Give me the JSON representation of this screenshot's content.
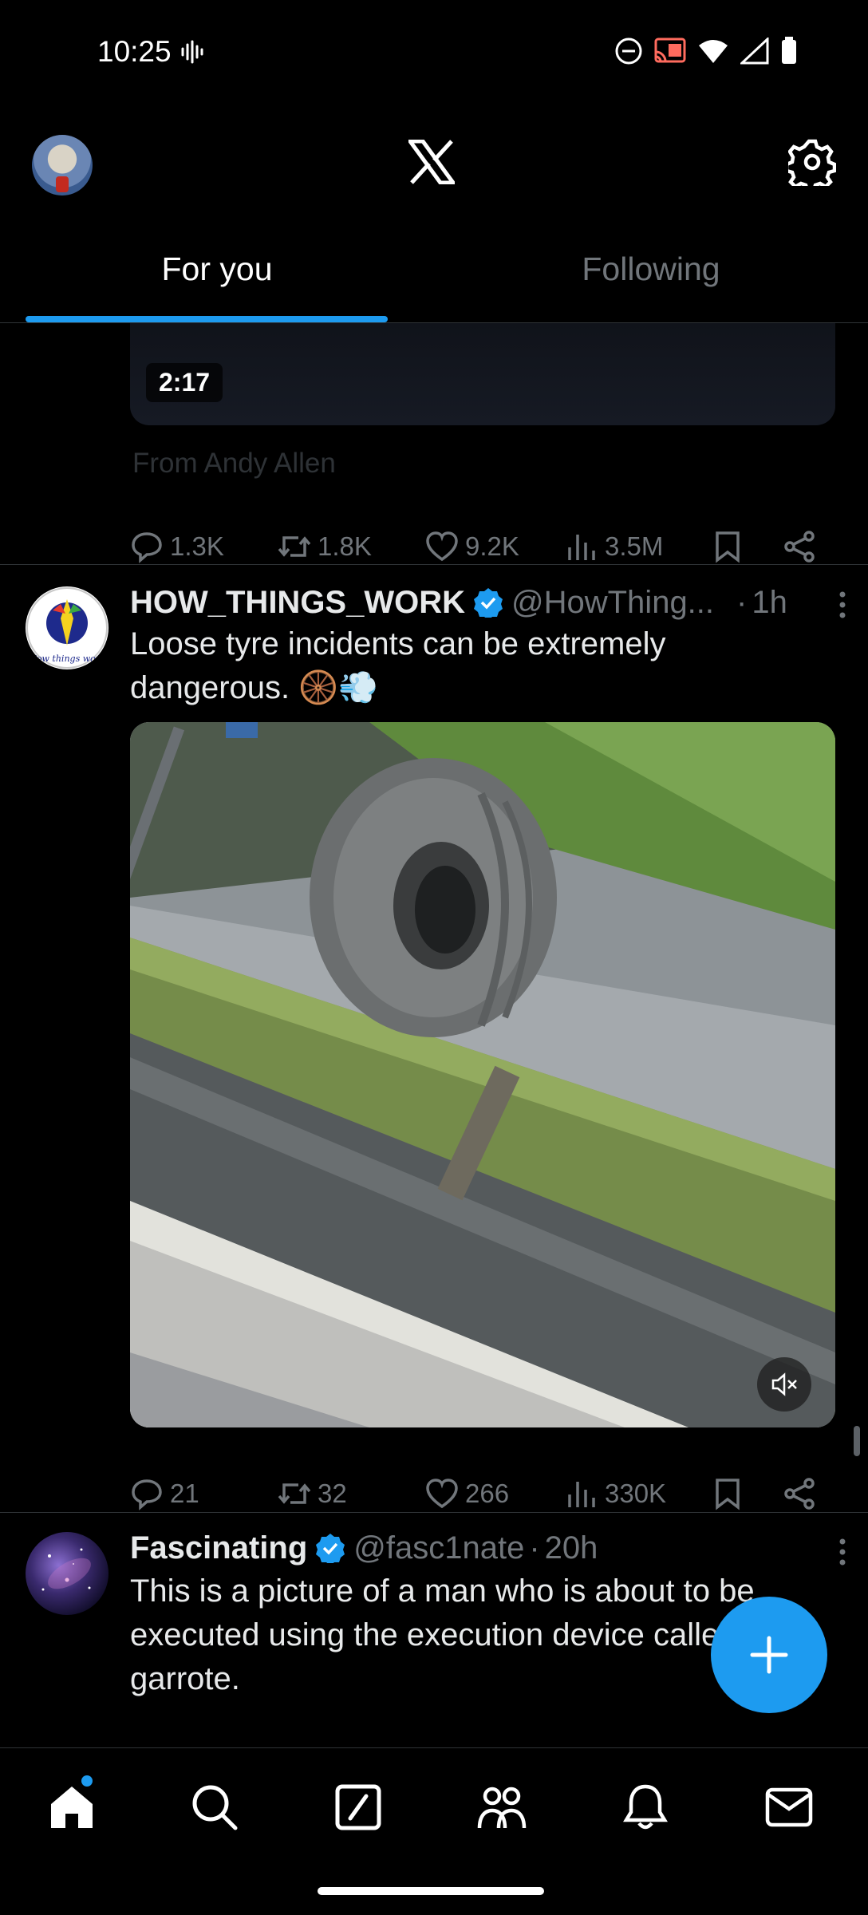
{
  "status_bar": {
    "time": "10:25"
  },
  "header": {
    "logo_icon": "x-logo-icon",
    "settings_icon": "gear-icon"
  },
  "tabs": [
    {
      "label": "For you",
      "active": true
    },
    {
      "label": "Following",
      "active": false
    }
  ],
  "previous_post": {
    "video_duration": "2:17",
    "from_line": "From Andy Allen",
    "stats": {
      "replies": "1.3K",
      "retweets": "1.8K",
      "likes": "9.2K",
      "views": "3.5M"
    }
  },
  "post1": {
    "name": "HOW_THINGS_WORK",
    "handle": "@HowThing...",
    "dot": "·",
    "time": "1h",
    "text": "Loose tyre incidents can be extremely dangerous. 🛞💨",
    "stats": {
      "replies": "21",
      "retweets": "32",
      "likes": "266",
      "views": "330K"
    },
    "avatar_text": "How things work"
  },
  "post2": {
    "name": "Fascinating",
    "handle": "@fasc1nate",
    "dot": "·",
    "time": "20h",
    "text": "This is a picture of a man who is about to be executed using the execution device called the garrote."
  },
  "colors": {
    "accent": "#1d9bf0",
    "muted": "#71767b",
    "text": "#e7e9ea",
    "divider": "#2f3336"
  },
  "bottom_nav": [
    "home-icon",
    "search-icon",
    "grok-icon",
    "communities-icon",
    "notifications-icon",
    "messages-icon"
  ]
}
